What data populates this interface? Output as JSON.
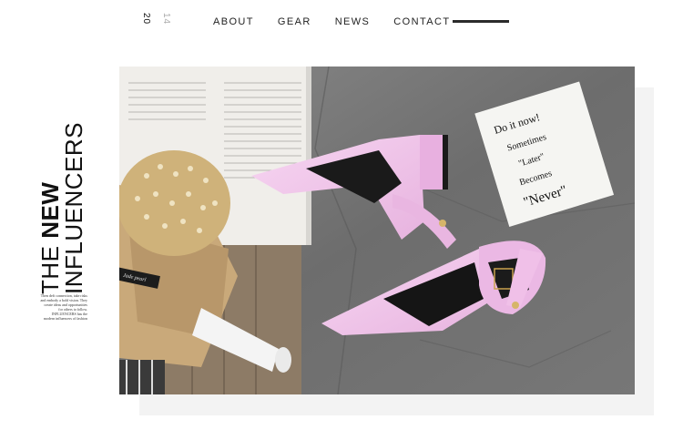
{
  "header": {
    "year_part1": "20",
    "year_part2": "14",
    "nav": [
      "ABOUT",
      "GEAR",
      "NEWS",
      "CONTACT"
    ]
  },
  "title": {
    "the": "THE ",
    "new": "NEW",
    "influencers": "INFLUENCERS"
  },
  "blurb": "Then deft connection, take risks and embody a bold vision. They create ideas and opportunities for others to follow. INFLUENCERS has the modern influencers of fashion",
  "hero": {
    "card_lines": [
      "Do it now!",
      "Sometimes",
      "\"Later\"",
      "Becomes",
      "\"Never\""
    ],
    "bouquet_tag": "Jade pearl",
    "colors": {
      "shoe": "#f2c4ec",
      "concrete": "#6f6f6f",
      "kraft": "#c9a97a"
    }
  }
}
